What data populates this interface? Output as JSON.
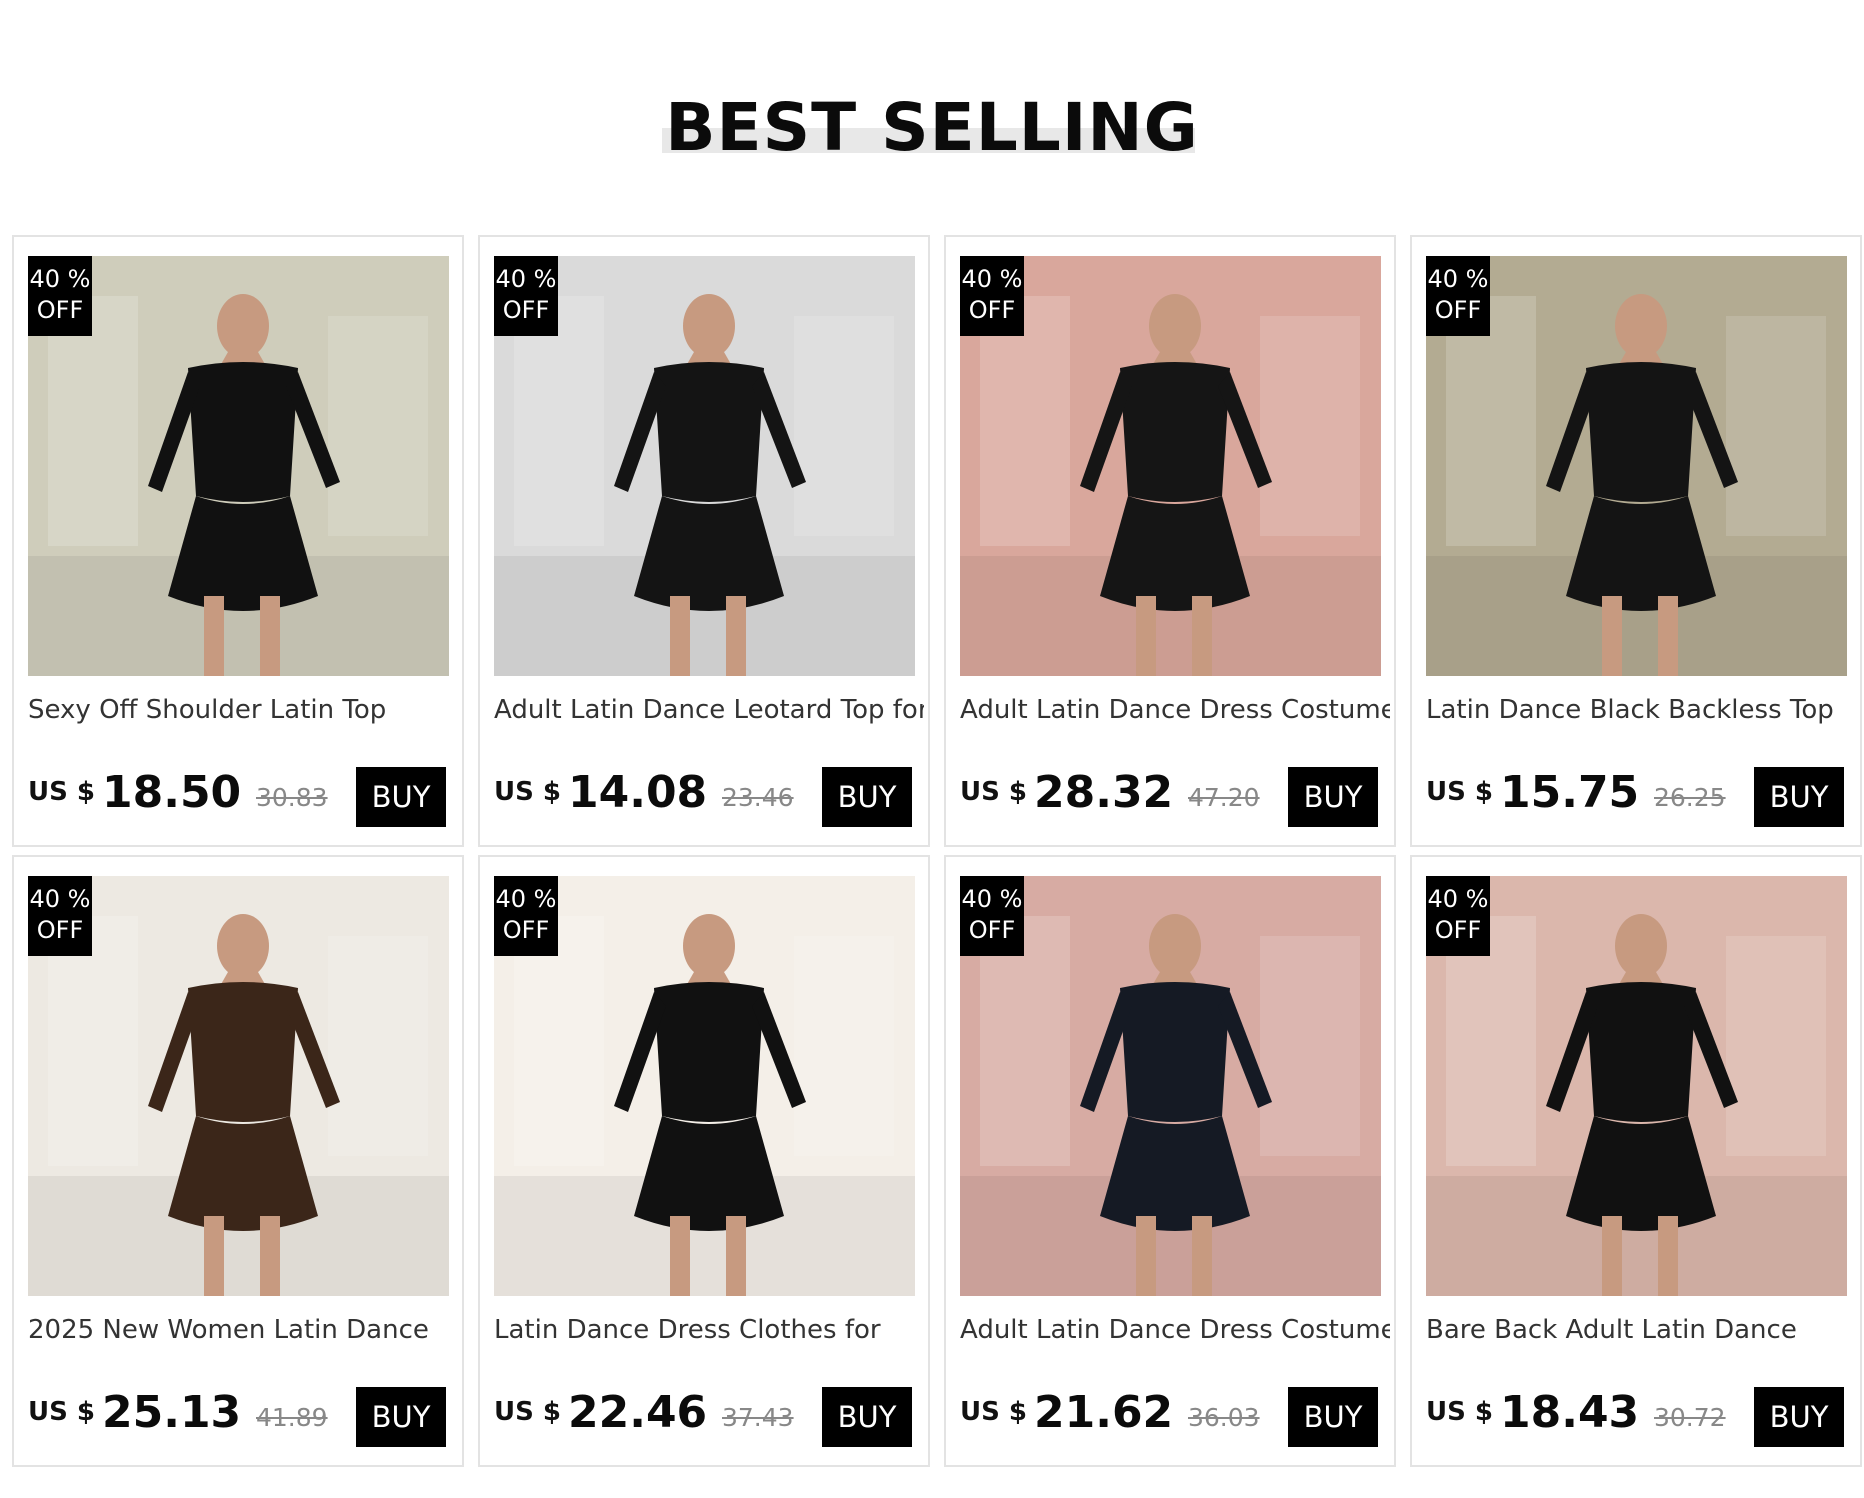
{
  "section": {
    "title": "BEST SELLING"
  },
  "products": [
    {
      "badge_pct": "40 %",
      "badge_off": "OFF",
      "title": "Sexy Off Shoulder Latin Top",
      "currency": "US $",
      "price": "18.50",
      "old_price": "30.83",
      "buy_label": "BUY",
      "bg": "#cfcdbb",
      "garment": "#111111"
    },
    {
      "badge_pct": "40 %",
      "badge_off": "OFF",
      "title": "Adult Latin Dance Leotard Top for",
      "currency": "US $",
      "price": "14.08",
      "old_price": "23.46",
      "buy_label": "BUY",
      "bg": "#dadada",
      "garment": "#141414"
    },
    {
      "badge_pct": "40 %",
      "badge_off": "OFF",
      "title": "Adult Latin Dance Dress Costume",
      "currency": "US $",
      "price": "28.32",
      "old_price": "47.20",
      "buy_label": "BUY",
      "bg": "#d9a79c",
      "garment": "#151515"
    },
    {
      "badge_pct": "40 %",
      "badge_off": "OFF",
      "title": "Latin Dance Black Backless Top",
      "currency": "US $",
      "price": "15.75",
      "old_price": "26.25",
      "buy_label": "BUY",
      "bg": "#b3ab92",
      "garment": "#141414"
    },
    {
      "badge_pct": "40 %",
      "badge_off": "OFF",
      "title": "2025 New Women Latin Dance",
      "currency": "US $",
      "price": "25.13",
      "old_price": "41.89",
      "buy_label": "BUY",
      "bg": "#ede9e2",
      "garment": "#3b2619"
    },
    {
      "badge_pct": "40 %",
      "badge_off": "OFF",
      "title": "Latin Dance Dress Clothes for",
      "currency": "US $",
      "price": "22.46",
      "old_price": "37.43",
      "buy_label": "BUY",
      "bg": "#f4efe8",
      "garment": "#111111"
    },
    {
      "badge_pct": "40 %",
      "badge_off": "OFF",
      "title": "Adult Latin Dance Dress Costume",
      "currency": "US $",
      "price": "21.62",
      "old_price": "36.03",
      "buy_label": "BUY",
      "bg": "#d7aba3",
      "garment": "#151a24"
    },
    {
      "badge_pct": "40 %",
      "badge_off": "OFF",
      "title": "Bare Back Adult Latin Dance",
      "currency": "US $",
      "price": "18.43",
      "old_price": "30.72",
      "buy_label": "BUY",
      "bg": "#dbb7ac",
      "garment": "#111111"
    }
  ]
}
